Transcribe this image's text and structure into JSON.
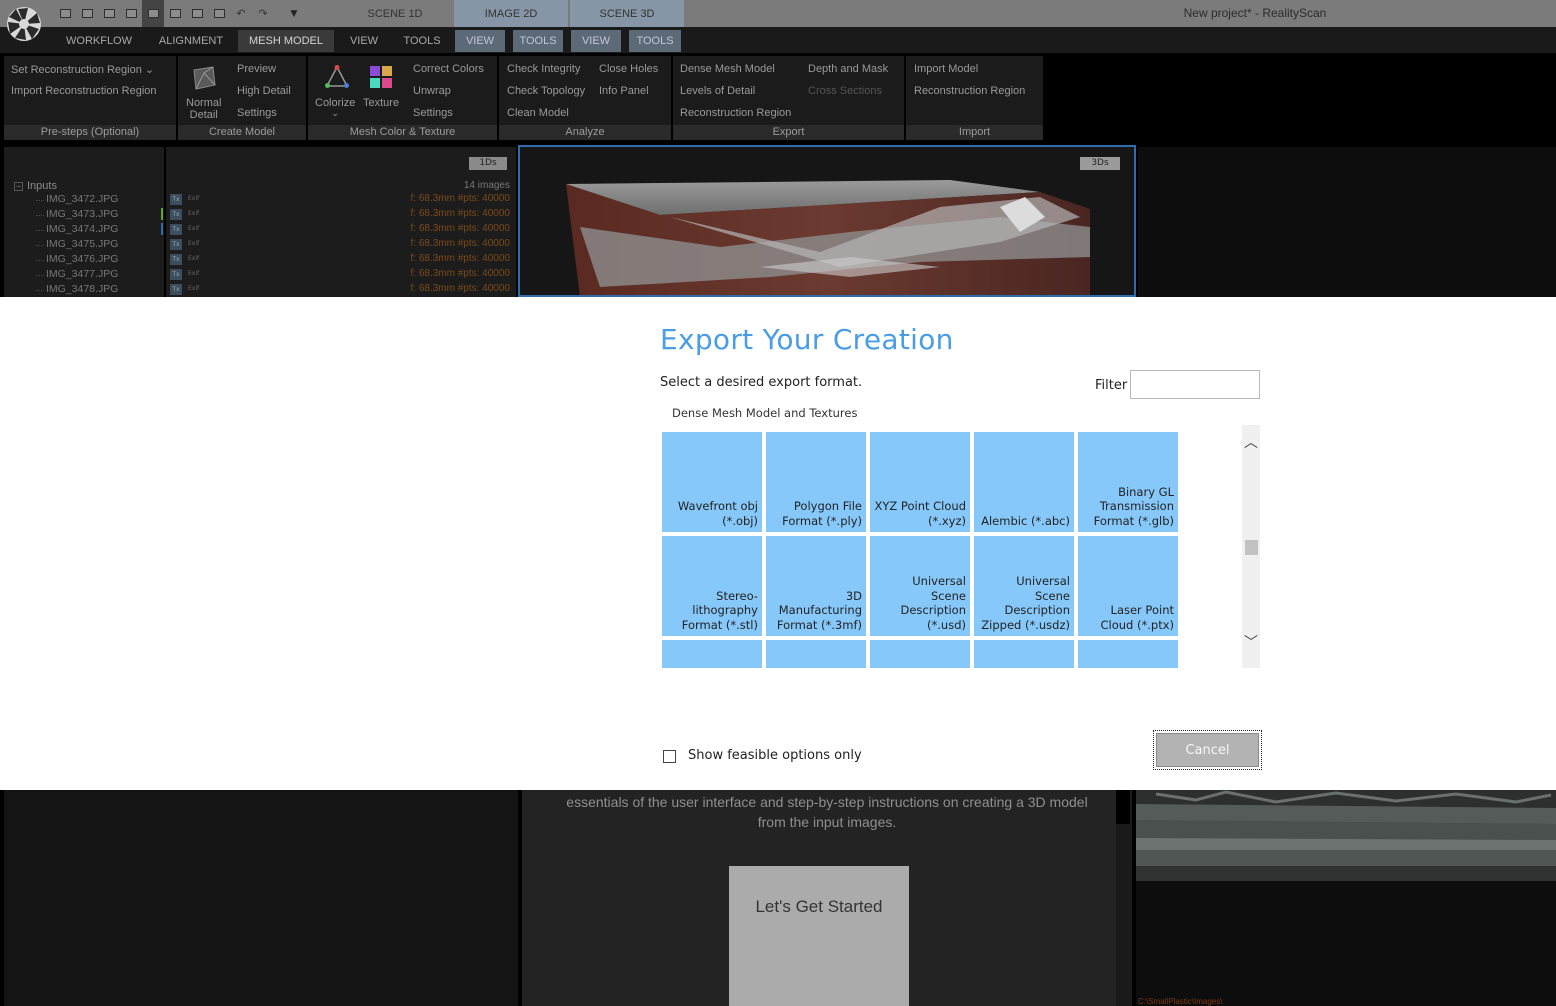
{
  "app": {
    "window_title": "New project* - RealityScan",
    "logo_icon": "aperture-logo-icon"
  },
  "quick_access": [
    {
      "name": "layout-1-icon",
      "glyph": ""
    },
    {
      "name": "layout-2-icon",
      "glyph": ""
    },
    {
      "name": "layout-3-icon",
      "glyph": ""
    },
    {
      "name": "layout-4-icon",
      "glyph": ""
    },
    {
      "name": "layout-5-icon",
      "glyph": ""
    },
    {
      "name": "layout-6-icon",
      "glyph": ""
    },
    {
      "name": "layout-7-icon",
      "glyph": ""
    },
    {
      "name": "layout-8-icon",
      "glyph": ""
    },
    {
      "name": "undo-icon",
      "glyph": "↶"
    },
    {
      "name": "redo-icon",
      "glyph": "↷"
    }
  ],
  "view_tabs": {
    "scene1d": "SCENE 1D",
    "image2d": "IMAGE 2D",
    "scene3d": "SCENE 3D"
  },
  "menu": {
    "workflow": "WORKFLOW",
    "alignment": "ALIGNMENT",
    "mesh_model": "MESH MODEL",
    "view": "VIEW",
    "tools": "TOOLS",
    "view_2": "VIEW",
    "tools_2": "TOOLS",
    "view_3": "VIEW",
    "tools_3": "TOOLS"
  },
  "ribbon": {
    "presteps": {
      "label": "Pre-steps (Optional)",
      "set_region": "Set Reconstruction Region",
      "set_region_arrow": "⌄",
      "import_region": "Import Reconstruction Region"
    },
    "create_model": {
      "label": "Create Model",
      "normal": "Normal",
      "detail": "Detail",
      "preview": "Preview",
      "high_detail": "High Detail",
      "settings": "Settings"
    },
    "color_texture": {
      "label": "Mesh Color & Texture",
      "colorize": "Colorize",
      "colorize_arrow": "⌄",
      "texture": "Texture",
      "correct_colors": "Correct Colors",
      "unwrap": "Unwrap",
      "settings": "Settings"
    },
    "analyze": {
      "label": "Analyze",
      "check_integrity": "Check Integrity",
      "check_topology": "Check Topology",
      "clean_model": "Clean Model",
      "close_holes": "Close Holes",
      "info_panel": "Info Panel"
    },
    "export": {
      "label": "Export",
      "dense_mesh": "Dense Mesh Model",
      "levels_of_detail": "Levels of Detail",
      "reconstruction_region": "Reconstruction Region",
      "depth_mask": "Depth and Mask",
      "cross_sections": "Cross Sections"
    },
    "import": {
      "label": "Import",
      "import_model": "Import Model",
      "reconstruction_region": "Reconstruction Region"
    }
  },
  "panels": {
    "inputs_badge": "1Ds",
    "view3d_badge": "3Ds",
    "inputs_root": "Inputs",
    "inputs_count": "14 images",
    "exif_label": "Exif",
    "tex_label": "Tx",
    "images": [
      {
        "name": "IMG_3472.JPG",
        "meta": "f: 68.3mm #pts: 40000",
        "mark": ""
      },
      {
        "name": "IMG_3473.JPG",
        "meta": "f: 68.3mm #pts: 40000",
        "mark": "#5aa832"
      },
      {
        "name": "IMG_3474.JPG",
        "meta": "f: 68.3mm #pts: 40000",
        "mark": "#2f6cae"
      },
      {
        "name": "IMG_3475.JPG",
        "meta": "f: 68.3mm #pts: 40000",
        "mark": ""
      },
      {
        "name": "IMG_3476.JPG",
        "meta": "f: 68.3mm #pts: 40000",
        "mark": ""
      },
      {
        "name": "IMG_3477.JPG",
        "meta": "f: 68.3mm #pts: 40000",
        "mark": ""
      },
      {
        "name": "IMG_3478.JPG",
        "meta": "f: 68.3mm #pts: 40000",
        "mark": ""
      }
    ],
    "welcome_text": "essentials of the user interface and step-by-step instructions on creating a 3D model from the input images.",
    "start_button": "Let's Get Started",
    "folder_path": "C:\\SmallPlastic\\Images\\"
  },
  "dialog": {
    "title": "Export Your Creation",
    "subtitle": "Select a desired export format.",
    "filter_label": "Filter",
    "filter_value": "",
    "section": "Dense Mesh Model and Textures",
    "formats": [
      "Wavefront obj (*.obj)",
      "Polygon File Format (*.ply)",
      "XYZ Point Cloud (*.xyz)",
      "Alembic (*.abc)",
      "Binary GL Transmission Format (*.glb)",
      "Stereo-lithography Format (*.stl)",
      "3D Manufacturing Format (*.3mf)",
      "Universal Scene Description (*.usd)",
      "Universal Scene Description Zipped (*.usdz)",
      "Laser Point Cloud (*.ptx)",
      "",
      "",
      "",
      "",
      ""
    ],
    "scroll_up": "︿",
    "scroll_down": "﹀",
    "scroll_position": 0.5,
    "feasible_label": "Show feasible options only",
    "feasible_checked": false,
    "cancel": "Cancel"
  },
  "colors": {
    "accent": "#4a9de5",
    "tile": "#87c8fa",
    "selection_border": "#2f6cae",
    "metadata_text": "#7a4a1a"
  }
}
